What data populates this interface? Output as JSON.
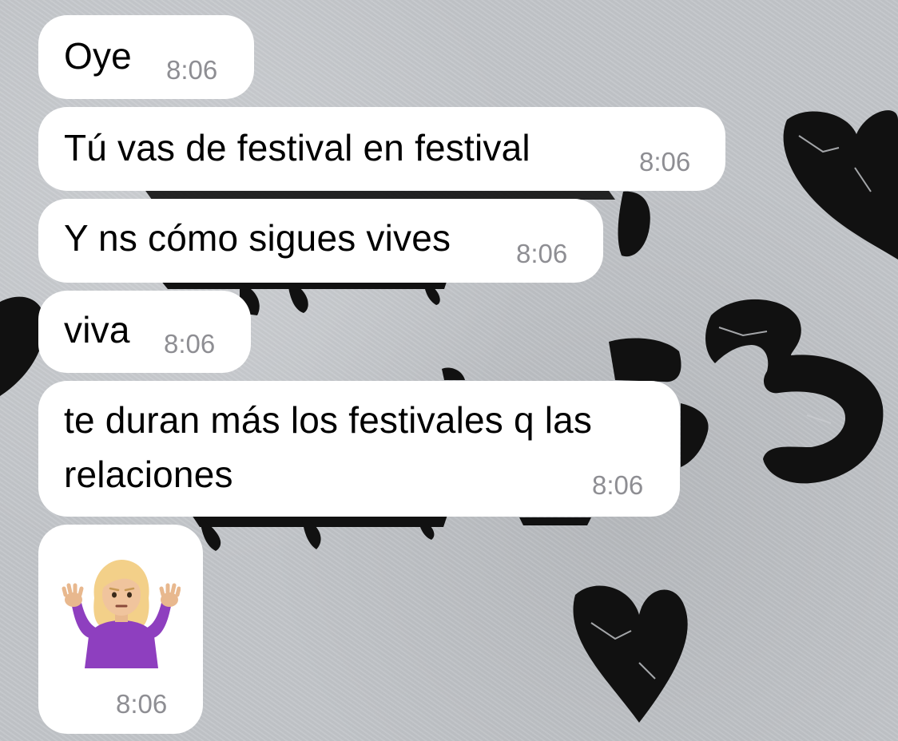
{
  "wallpaper": {
    "description_icons": [
      "heart-doodle-icon",
      "heart-doodle-icon",
      "heart-doodle-icon",
      "squiggle-doodle-icon"
    ],
    "background_color": "#c3c6ca",
    "doodle_color": "#111111"
  },
  "messages": [
    {
      "text": "Oye",
      "time": "8:06"
    },
    {
      "text": "Tú vas de festival en festival",
      "time": "8:06"
    },
    {
      "text": "Y ns cómo sigues vives",
      "time": "8:06"
    },
    {
      "text": "viva",
      "time": "8:06"
    },
    {
      "text_line1": "te duran más los festivales q las",
      "text_line2": "relaciones",
      "time": "8:06"
    },
    {
      "emoji": "woman-shrugging-emoji",
      "time": "8:06"
    }
  ],
  "colors": {
    "bubble": "#ffffff",
    "text": "#000000",
    "timestamp": "#8e8e93"
  }
}
